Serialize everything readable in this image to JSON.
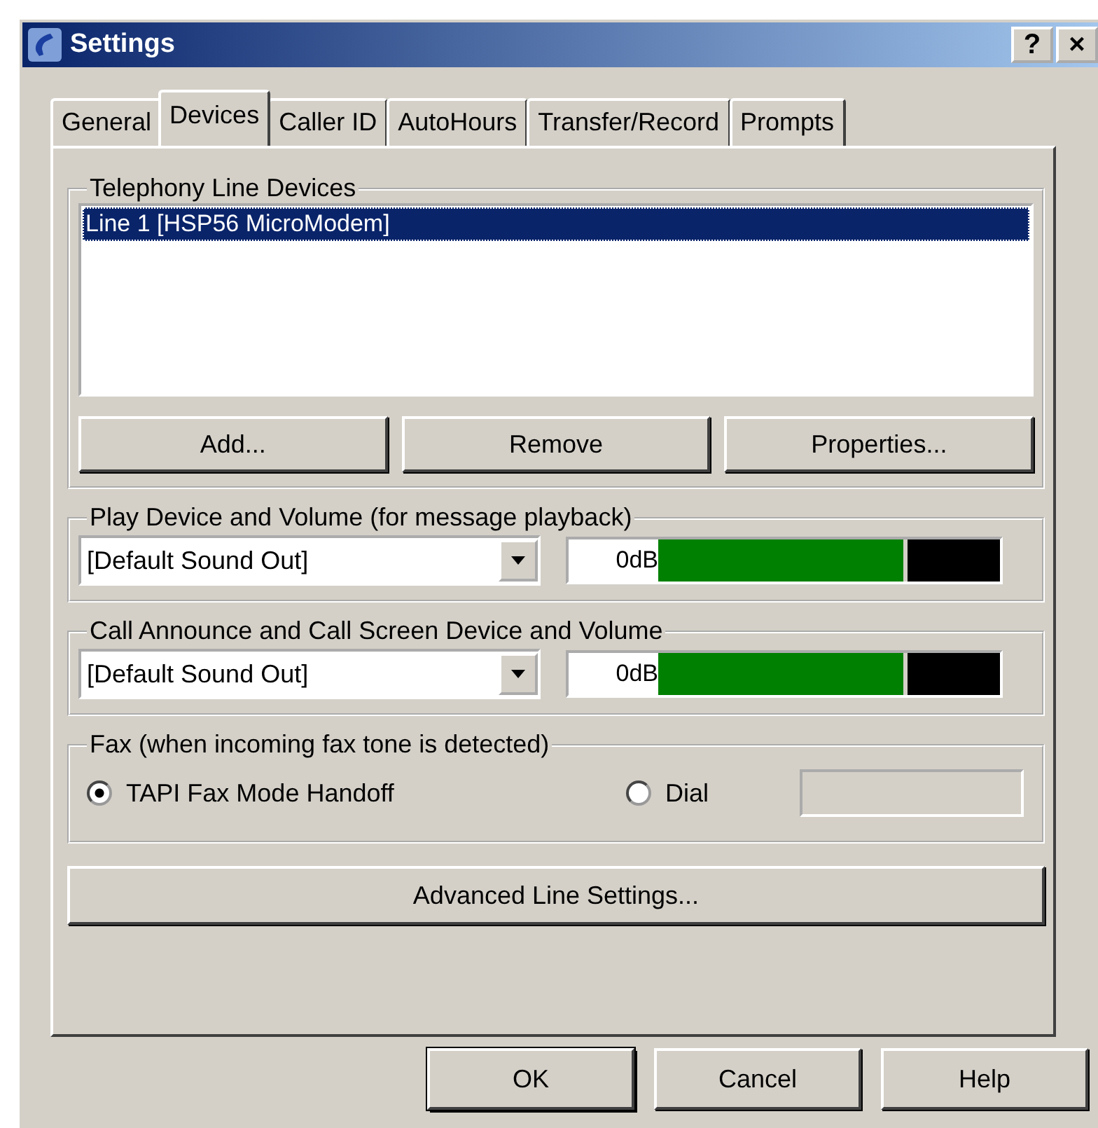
{
  "window": {
    "title": "Settings",
    "help_button": "?",
    "close_button": "×"
  },
  "tabs": [
    {
      "label": "General",
      "selected": false
    },
    {
      "label": "Devices",
      "selected": true
    },
    {
      "label": "Caller ID",
      "selected": false
    },
    {
      "label": "AutoHours",
      "selected": false
    },
    {
      "label": "Transfer/Record",
      "selected": false
    },
    {
      "label": "Prompts",
      "selected": false
    }
  ],
  "line_devices": {
    "title": "Telephony Line Devices",
    "items": [
      {
        "label": "Line 1 [HSP56 MicroModem]",
        "selected": true
      }
    ],
    "buttons": [
      "Add...",
      "Remove",
      "Properties..."
    ]
  },
  "audio_groups": [
    {
      "title": "Play Device and Volume (for message playback)",
      "device": "[Default Sound Out]",
      "volume_reading": "0dB",
      "level": 0.73
    },
    {
      "title": "Call Announce and Call Screen Device and Volume",
      "device": "[Default Sound Out]",
      "volume_reading": "0dB",
      "level": 0.73
    }
  ],
  "fax": {
    "title": "Fax (when incoming fax tone is detected)",
    "options": [
      {
        "label": "TAPI Fax Mode Handoff",
        "selected": true
      },
      {
        "label": "Dial",
        "selected": false
      }
    ],
    "dial_field_disabled": true
  },
  "advanced_button": "Advanced Line Settings...",
  "buttons": [
    {
      "label": "OK",
      "default": true
    },
    {
      "label": "Cancel",
      "default": false
    },
    {
      "label": "Help",
      "default": false
    }
  ]
}
